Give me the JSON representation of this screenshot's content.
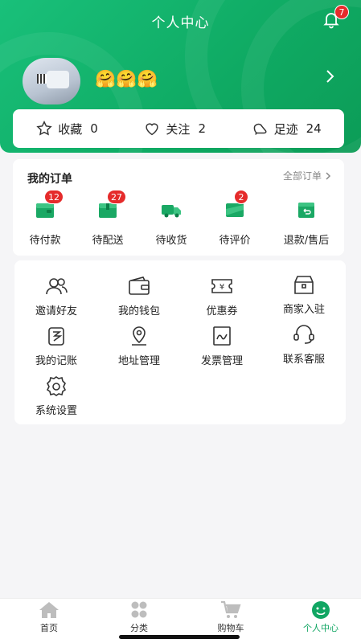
{
  "header": {
    "title": "个人中心",
    "notification_count": "7",
    "nickname": "🤗🤗🤗",
    "accent_color": "#11a663"
  },
  "stats": [
    {
      "label": "收藏",
      "value": "0",
      "icon": "star-icon"
    },
    {
      "label": "关注",
      "value": "2",
      "icon": "heart-icon"
    },
    {
      "label": "足迹",
      "value": "24",
      "icon": "footprint-icon"
    }
  ],
  "orders": {
    "title": "我的订单",
    "all_label": "全部订单",
    "items": [
      {
        "label": "待付款",
        "badge": "12",
        "icon": "wallet-icon"
      },
      {
        "label": "待配送",
        "badge": "27",
        "icon": "package-icon"
      },
      {
        "label": "待收货",
        "badge": "",
        "icon": "truck-icon"
      },
      {
        "label": "待评价",
        "badge": "2",
        "icon": "comment-icon"
      },
      {
        "label": "退款/售后",
        "badge": "",
        "icon": "refund-icon"
      }
    ]
  },
  "services": [
    {
      "label": "邀请好友",
      "icon": "users-icon"
    },
    {
      "label": "我的钱包",
      "icon": "wallet-icon"
    },
    {
      "label": "优惠券",
      "icon": "coupon-icon"
    },
    {
      "label": "商家入驻",
      "icon": "shop-icon"
    },
    {
      "label": "我的记账",
      "icon": "ledger-icon"
    },
    {
      "label": "地址管理",
      "icon": "location-icon"
    },
    {
      "label": "发票管理",
      "icon": "invoice-icon"
    },
    {
      "label": "联系客服",
      "icon": "headset-icon"
    },
    {
      "label": "系统设置",
      "icon": "gear-icon"
    }
  ],
  "tabbar": [
    {
      "label": "首页",
      "icon": "home-icon",
      "active": false
    },
    {
      "label": "分类",
      "icon": "category-icon",
      "active": false
    },
    {
      "label": "购物车",
      "icon": "cart-icon",
      "active": false
    },
    {
      "label": "个人中心",
      "icon": "profile-icon",
      "active": true
    }
  ]
}
